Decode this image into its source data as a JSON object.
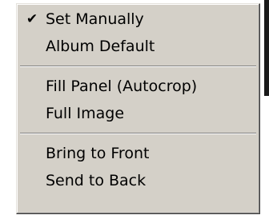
{
  "menu": {
    "groups": [
      {
        "items": [
          {
            "label": "Set Manually",
            "checked": true,
            "check_glyph": "✔"
          },
          {
            "label": "Album Default",
            "checked": false
          }
        ]
      },
      {
        "items": [
          {
            "label": "Fill Panel (Autocrop)",
            "checked": false
          },
          {
            "label": "Full Image",
            "checked": false
          }
        ]
      },
      {
        "items": [
          {
            "label": "Bring to Front",
            "checked": false
          },
          {
            "label": "Send to Back",
            "checked": false
          }
        ]
      }
    ]
  },
  "colors": {
    "menu_background": "#d4d0c8",
    "text": "#000000",
    "separator_dark": "#808080",
    "separator_light": "#ffffff"
  }
}
